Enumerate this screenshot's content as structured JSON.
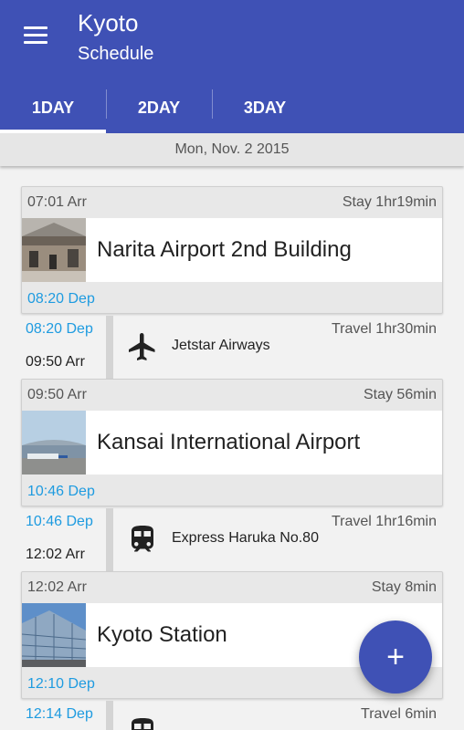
{
  "app": {
    "title": "Kyoto",
    "subtitle": "Schedule"
  },
  "tabs": [
    {
      "label": "1DAY",
      "active": true
    },
    {
      "label": "2DAY",
      "active": false
    },
    {
      "label": "3DAY",
      "active": false
    }
  ],
  "date": "Mon, Nov. 2 2015",
  "colors": {
    "primary": "#3f51b5",
    "departure": "#1e9be0"
  },
  "stays": [
    {
      "arr": "07:01 Arr",
      "stay": "Stay 1hr19min",
      "name": "Narita Airport 2nd Building",
      "dep": "08:20 Dep"
    },
    {
      "arr": "09:50 Arr",
      "stay": "Stay 56min",
      "name": "Kansai International Airport",
      "dep": "10:46 Dep"
    },
    {
      "arr": "12:02 Arr",
      "stay": "Stay 8min",
      "name": "Kyoto Station",
      "dep": "12:10 Dep"
    }
  ],
  "travels": [
    {
      "dep": "08:20 Dep",
      "arr": "09:50 Arr",
      "icon": "airplane-icon",
      "carrier": "Jetstar Airways",
      "duration": "Travel 1hr30min"
    },
    {
      "dep": "10:46 Dep",
      "arr": "12:02 Arr",
      "icon": "train-icon",
      "carrier": "Express Haruka No.80",
      "duration": "Travel 1hr16min"
    },
    {
      "dep": "12:14 Dep",
      "arr": "",
      "icon": "train-icon",
      "carrier": "",
      "duration": "Travel 6min"
    }
  ],
  "fab": {
    "label": "+"
  }
}
